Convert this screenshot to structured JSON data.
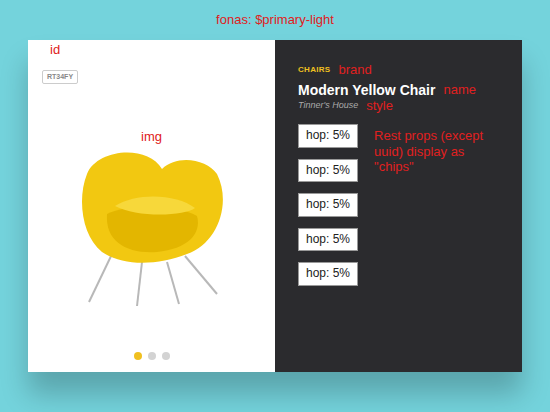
{
  "page": {
    "annotation": "fonas: $primary-light"
  },
  "product": {
    "id": "RT34FY",
    "brand": "CHAIRS",
    "name": "Modern Yellow Chair",
    "style": "Tinner's House"
  },
  "annotations": {
    "id": "id",
    "img": "img",
    "brand": "brand",
    "name": "name",
    "style": "style",
    "chips": "Rest props (except uuid) display as \"chips\""
  },
  "chips": [
    {
      "label": "hop: 5%"
    },
    {
      "label": "hop: 5%"
    },
    {
      "label": "hop: 5%"
    },
    {
      "label": "hop: 5%"
    },
    {
      "label": "hop: 5%"
    }
  ],
  "carousel": [
    {
      "selected": true
    },
    {
      "selected": false
    },
    {
      "selected": false
    }
  ]
}
